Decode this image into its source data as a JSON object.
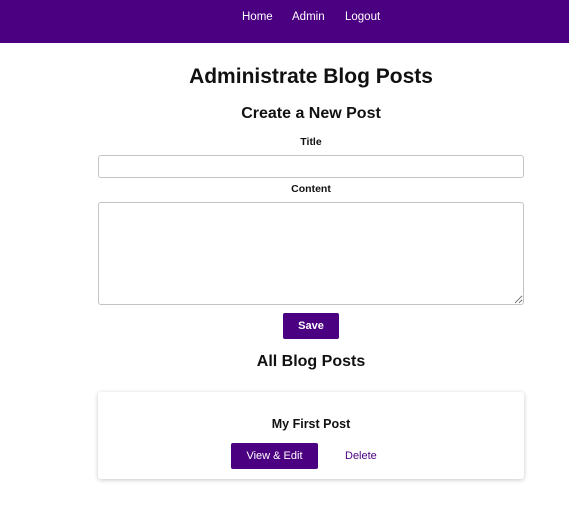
{
  "nav": {
    "items": [
      {
        "label": "Home"
      },
      {
        "label": "Admin"
      },
      {
        "label": "Logout"
      }
    ]
  },
  "page": {
    "title": "Administrate Blog Posts"
  },
  "create_form": {
    "heading": "Create a New Post",
    "title_label": "Title",
    "title_value": "",
    "content_label": "Content",
    "content_value": "",
    "save_label": "Save"
  },
  "posts_section": {
    "heading": "All Blog Posts",
    "posts": [
      {
        "title": "My First Post",
        "view_edit_label": "View & Edit",
        "delete_label": "Delete"
      }
    ]
  },
  "colors": {
    "brand": "#4b0082",
    "background": "#ffffff",
    "text": "#111111",
    "input_border": "#c4c4c4"
  }
}
